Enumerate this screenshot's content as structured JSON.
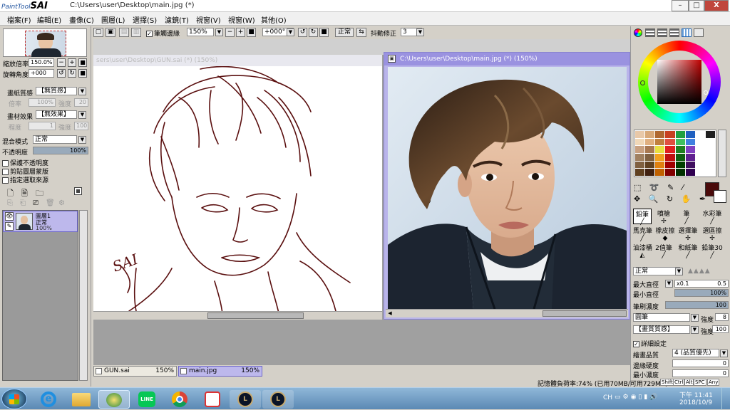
{
  "app": {
    "logo_small": "PaintTool",
    "logo_big": "SAI",
    "window_title": "C:\\Users\\user\\Desktop\\main.jpg (*)",
    "win_min": "–",
    "win_max": "□",
    "win_close": "X"
  },
  "menu": [
    "檔案(F)",
    "編輯(E)",
    "畫像(C)",
    "圖層(L)",
    "選擇(S)",
    "濾鏡(T)",
    "視窗(V)",
    "視窗(W)",
    "其他(O)"
  ],
  "toolbar": {
    "antialias_label": "筆觸邊緣",
    "zoom": "150%",
    "rotation": "+000°",
    "blend": "正常",
    "stabilizer_label": "抖動修正",
    "stabilizer": "3"
  },
  "navigator": {
    "zoom_label": "縮放倍率",
    "zoom": "150.0%",
    "angle_label": "旋轉角度",
    "angle": "+000"
  },
  "paper": {
    "texture_label": "畫紙質感",
    "texture": "【無質感】",
    "scale_label": "倍率",
    "scale": "100%",
    "strength_label": "強度",
    "strength": "20",
    "effect_label": "畫材效果",
    "effect": "【無效果】",
    "level_label": "程度",
    "level": "1",
    "effect_strength_label": "強度",
    "effect_strength": "100"
  },
  "layer_props": {
    "blend_label": "混合模式",
    "blend": "正常",
    "opacity_label": "不透明度",
    "opacity": "100%",
    "opacity_value": 100,
    "opt1": "保護不透明度",
    "opt2": "剪貼圖層蒙版",
    "opt3": "指定選取來源"
  },
  "layers": [
    {
      "name": "圖層1",
      "mode": "正常",
      "opacity": "100%"
    }
  ],
  "canvas": {
    "gun_title": "sers\\user\\Desktop\\GUN.sai (*) (150%)",
    "gun_signature": "SAI",
    "main_title": "C:\\Users\\user\\Desktop\\main.jpg (*) (150%)"
  },
  "tabs": [
    {
      "name": "GUN.sai",
      "zoom": "150%"
    },
    {
      "name": "main.jpg",
      "zoom": "150%"
    }
  ],
  "brushes": [
    [
      "鉛筆",
      "噴槍",
      "筆",
      "水彩筆"
    ],
    [
      "馬克筆",
      "橡皮擦",
      "選擇筆",
      "選區擦"
    ],
    [
      "油漆桶",
      "2值筆",
      "和紙筆",
      "鉛筆30"
    ]
  ],
  "brush_settings": {
    "blend": "正常",
    "max_size_label": "最大直徑",
    "max_size_mult": "x0.1",
    "max_size": "0.5",
    "min_size_label": "最小直徑",
    "min_size": "100%",
    "min_size_value": 100,
    "density_label": "筆刷濃度",
    "density": "100",
    "density_value": 100,
    "shape_label": "圓筆",
    "shape_strength_label": "強度",
    "shape_strength": "8",
    "texture_label": "【畫質質感】",
    "texture_strength_label": "強度",
    "texture_strength": "100",
    "advanced_label": "詳細設定",
    "quality_label": "繪畫品質",
    "quality": "4 (品質優先)",
    "edge_label": "邊緣硬度",
    "edge": "0",
    "min_density_label": "最小濃度",
    "min_density": "0"
  },
  "colors": {
    "primary": "#4a0a0a",
    "secondary": "#ffffff",
    "accent": "#9a92e0",
    "sketch": "#5a0f0f",
    "swatches": [
      "#e8c8a8",
      "#d8a878",
      "#b06830",
      "#c84020",
      "#20a040",
      "#2060c0",
      "#ffffff",
      "#202020",
      "#f0d8b8",
      "#e0b080",
      "#c08040",
      "#e05040",
      "#40c060",
      "#4080e0",
      "#ffffff",
      "#ffffff",
      "#c8a080",
      "#a87850",
      "#e8e040",
      "#e02020",
      "#208020",
      "#8040c0",
      "#ffffff",
      "#ffffff",
      "#a08060",
      "#806040",
      "#f0a020",
      "#c01010",
      "#106010",
      "#602090",
      "#ffffff",
      "#ffffff",
      "#806040",
      "#604020",
      "#e08010",
      "#a00000",
      "#004000",
      "#401060",
      "#ffffff",
      "#ffffff",
      "#604020",
      "#402010",
      "#c06000",
      "#800000",
      "#003000",
      "#300050",
      "#ffffff",
      "#ffffff"
    ]
  },
  "status": {
    "memory": "記憶體負荷率:74% (已用70MB/可用729MB)",
    "keys": [
      "Shift",
      "Ctrl",
      "Alt",
      "SPC",
      "Any"
    ]
  },
  "taskbar": {
    "lang": "CH",
    "time": "下午 11:41",
    "date": "2018/10/9",
    "apps": [
      "start",
      "ie",
      "explorer",
      "sai",
      "line",
      "chrome",
      "game",
      "league1",
      "league2"
    ]
  }
}
